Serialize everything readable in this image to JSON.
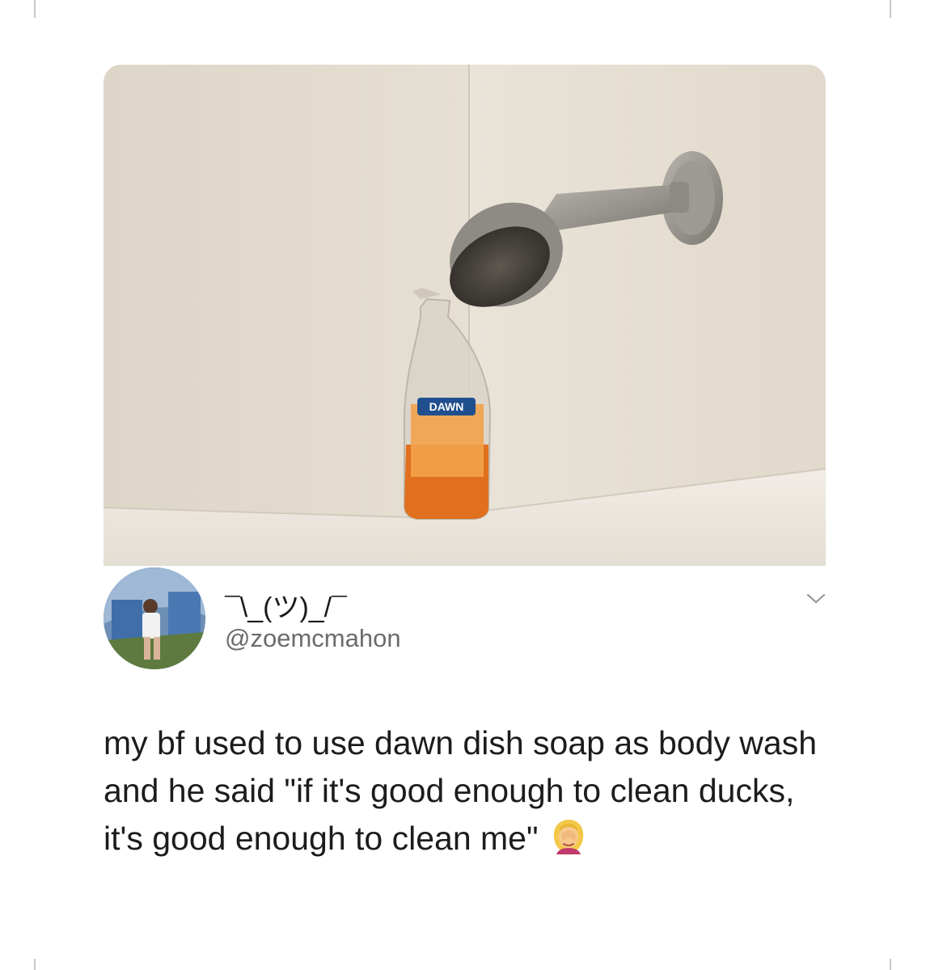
{
  "user": {
    "display_name": "¯\\_(ツ)_/¯",
    "handle": "@zoemcmahon",
    "avatar_icon": "profile-photo"
  },
  "tweet": {
    "text": "my bf used to use dawn dish soap as body wash and he said \"if it's good enough to clean ducks, it's good enough to clean me\"",
    "emoji_icon": "woman-facepalming"
  },
  "photo": {
    "bottle_label": "DAWN"
  },
  "colors": {
    "wall": "#e3dccf",
    "soap": "#e0701e",
    "handle_gray": "#6b6b6b",
    "text": "#1c1c1c"
  }
}
